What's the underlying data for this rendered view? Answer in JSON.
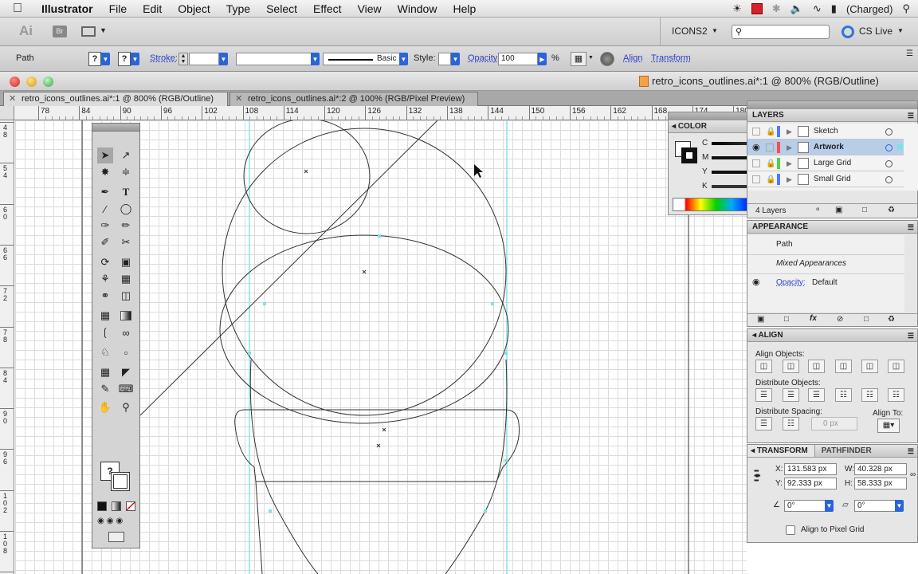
{
  "menubar": {
    "app_name": "Illustrator",
    "items": [
      "File",
      "Edit",
      "Object",
      "Type",
      "Select",
      "Effect",
      "View",
      "Window",
      "Help"
    ],
    "battery_status": "(Charged)"
  },
  "appbar": {
    "ai_badge": "Ai",
    "br_badge": "Br",
    "workspace": "ICONS2",
    "cs_live": "CS Live"
  },
  "control": {
    "selection_label": "Path",
    "stroke_label": "Stroke:",
    "brush_preset": "Basic",
    "style_label": "Style:",
    "opacity_label": "Opacity:",
    "opacity_value": "100",
    "opacity_unit": "%",
    "align_link": "Align",
    "transform_link": "Transform"
  },
  "window": {
    "title": "retro_icons_outlines.ai*:1 @ 800% (RGB/Outline)"
  },
  "tabs": [
    {
      "label": "retro_icons_outlines.ai*:1 @ 800% (RGB/Outline)"
    },
    {
      "label": "retro_icons_outlines.ai*:2 @ 100% (RGB/Pixel Preview)"
    }
  ],
  "ruler": {
    "top_ticks": [
      "78",
      "84",
      "90",
      "96",
      "102",
      "108",
      "114",
      "120",
      "126",
      "132",
      "138",
      "144",
      "150",
      "156",
      "162",
      "168",
      "174",
      "180"
    ],
    "left_ticks": [
      "48",
      "54",
      "60",
      "66",
      "72",
      "78",
      "84",
      "90",
      "96",
      "102",
      "108",
      "114"
    ]
  },
  "color_panel": {
    "title": "COLOR",
    "channels": [
      "C",
      "M",
      "Y",
      "K"
    ]
  },
  "layers_panel": {
    "title": "LAYERS",
    "layers": [
      {
        "name": "Sketch",
        "color": "#4f7bff"
      },
      {
        "name": "Artwork",
        "color": "#ff4d4d"
      },
      {
        "name": "Large Grid",
        "color": "#4fd04f"
      },
      {
        "name": "Small Grid",
        "color": "#4f7bff"
      }
    ],
    "count": "4 Layers"
  },
  "appearance_panel": {
    "title": "APPEARANCE",
    "object": "Path",
    "mixed": "Mixed Appearances",
    "opacity_label": "Opacity:",
    "opacity_value": "Default"
  },
  "align_panel": {
    "title": "ALIGN",
    "align_objects": "Align Objects:",
    "distribute_objects": "Distribute Objects:",
    "distribute_spacing": "Distribute Spacing:",
    "align_to": "Align To:",
    "spacing_value": "0 px"
  },
  "transform_panel": {
    "title": "TRANSFORM",
    "tab2": "PATHFINDER",
    "x_label": "X:",
    "x_value": "131.583 px",
    "y_label": "Y:",
    "y_value": "92.333 px",
    "w_label": "W:",
    "w_value": "40.328 px",
    "h_label": "H:",
    "h_value": "58.333 px",
    "rotate_value": "0°",
    "shear_value": "0°",
    "pixel_grid_label": "Align to Pixel Grid"
  },
  "colors": {
    "accent_blue": "#2a64d8",
    "guide_cyan": "#7fe0e6"
  }
}
